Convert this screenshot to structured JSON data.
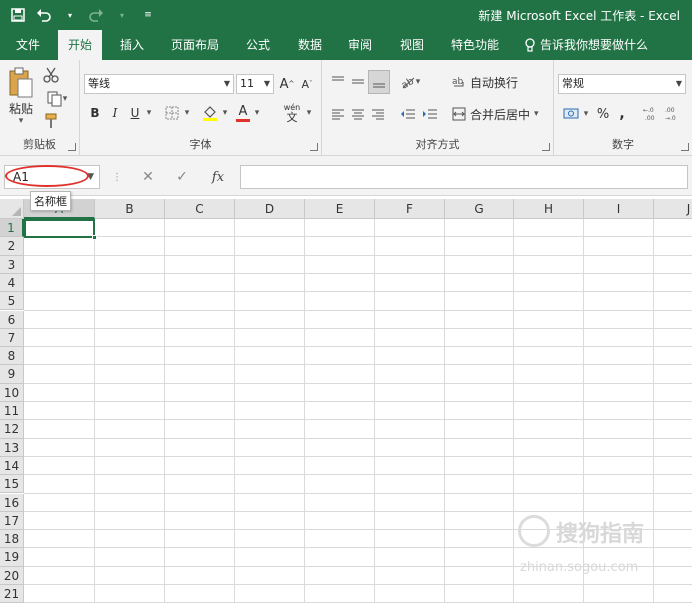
{
  "title_bar": {
    "title": "新建 Microsoft Excel 工作表 - Excel",
    "save_icon": "save-icon",
    "undo_icon": "undo-icon",
    "redo_icon": "redo-icon",
    "customize_icon": "qat-customize-icon"
  },
  "tabs": [
    "文件",
    "开始",
    "插入",
    "页面布局",
    "公式",
    "数据",
    "审阅",
    "视图",
    "特色功能"
  ],
  "active_tab": "开始",
  "tell_me": "告诉我你想要做什么",
  "ribbon": {
    "clipboard": {
      "label": "剪贴板",
      "paste": "粘贴"
    },
    "font": {
      "label": "字体",
      "font_name": "等线",
      "font_size": "11",
      "grow": "A",
      "shrink": "A",
      "bold": "B",
      "italic": "I",
      "underline": "U",
      "font_color": "A",
      "phonetic": "wén"
    },
    "alignment": {
      "label": "对齐方式",
      "wrap_text": "自动换行",
      "merge_center": "合并后居中"
    },
    "number": {
      "label": "数字",
      "format": "常规",
      "percent": "%",
      "comma": ","
    }
  },
  "formula_bar": {
    "name_box": "A1",
    "fx": "fx",
    "cancel": "✕",
    "enter": "✓",
    "tooltip": "名称框"
  },
  "columns": [
    "A",
    "B",
    "C",
    "D",
    "E",
    "F",
    "G",
    "H",
    "I",
    "J"
  ],
  "rows": [
    "1",
    "2",
    "3",
    "4",
    "5",
    "6",
    "7",
    "8",
    "9",
    "10",
    "11",
    "12",
    "13",
    "14",
    "15",
    "16",
    "17",
    "18",
    "19",
    "20",
    "21"
  ],
  "watermark": {
    "text": "搜狗指南",
    "url_text": "zhinan.sogou.com"
  },
  "colors": {
    "excel_green": "#217346",
    "ribbon_bg": "#f3f3f3",
    "annotation_red": "#e0312b"
  }
}
